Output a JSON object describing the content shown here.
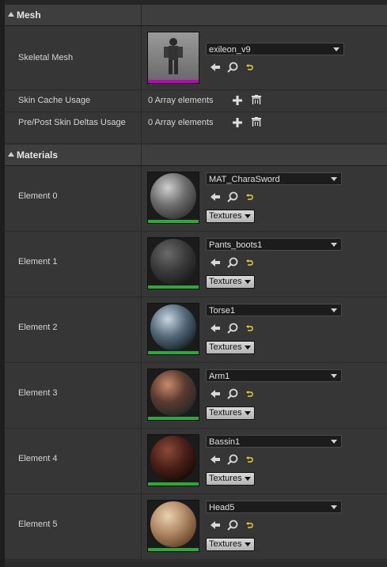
{
  "mesh": {
    "category_title": "Mesh",
    "skeletal_mesh_label": "Skeletal Mesh",
    "skeletal_mesh_value": "exileon_v9",
    "skin_cache_label": "Skin Cache Usage",
    "skin_cache_value": "0 Array elements",
    "skin_deltas_label": "Pre/Post Skin Deltas Usage",
    "skin_deltas_value": "0 Array elements"
  },
  "materials": {
    "category_title": "Materials",
    "textures_label": "Textures",
    "elements": [
      {
        "label": "Element 0",
        "value": "MAT_CharaSword"
      },
      {
        "label": "Element 1",
        "value": "Pants_boots1"
      },
      {
        "label": "Element 2",
        "value": "Torse1"
      },
      {
        "label": "Element 3",
        "value": "Arm1"
      },
      {
        "label": "Element 4",
        "value": "Bassin1"
      },
      {
        "label": "Element 5",
        "value": "Head5"
      }
    ]
  },
  "colors": {
    "mesh_asset_bar": "#c000c0",
    "material_asset_bar": "#2fa83a",
    "reset_arrow": "#e6d23a"
  }
}
